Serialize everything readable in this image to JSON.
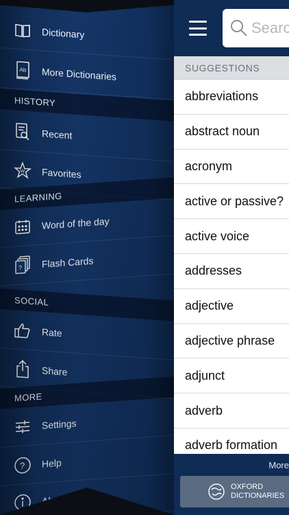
{
  "menu": {
    "items_top": [
      {
        "label": "Dictionary",
        "icon": "book-icon"
      },
      {
        "label": "More Dictionaries",
        "icon": "dictionary-ab-icon"
      }
    ],
    "sections": [
      {
        "title": "HISTORY",
        "items": [
          {
            "label": "Recent",
            "icon": "recent-document-search-icon"
          },
          {
            "label": "Favorites",
            "icon": "star-w-icon"
          }
        ]
      },
      {
        "title": "LEARNING",
        "items": [
          {
            "label": "Word of the day",
            "icon": "calendar-icon"
          },
          {
            "label": "Flash Cards",
            "icon": "flash-cards-icon"
          }
        ]
      },
      {
        "title": "SOCIAL",
        "items": [
          {
            "label": "Rate",
            "icon": "thumbs-up-icon"
          },
          {
            "label": "Share",
            "icon": "share-icon"
          }
        ]
      },
      {
        "title": "MORE",
        "items": [
          {
            "label": "Settings",
            "icon": "sliders-icon"
          },
          {
            "label": "Help",
            "icon": "help-icon"
          },
          {
            "label": "About",
            "icon": "info-icon"
          }
        ]
      }
    ]
  },
  "search": {
    "placeholder": "Search"
  },
  "suggestions": {
    "header": "SUGGESTIONS",
    "items": [
      "abbreviations",
      "abstract noun",
      "acronym",
      "active or passive?",
      "active voice",
      "addresses",
      "adjective",
      "adjective phrase",
      "adjunct",
      "adverb",
      "adverb formation"
    ]
  },
  "footer": {
    "more_label": "More",
    "brand_line1": "OXFORD",
    "brand_line2": "DICTIONARIES"
  },
  "colors": {
    "menu_bg": "#153668",
    "topbar_bg": "#0f2c55",
    "list_bg": "#ffffff",
    "header_bg": "#dcdee2"
  }
}
